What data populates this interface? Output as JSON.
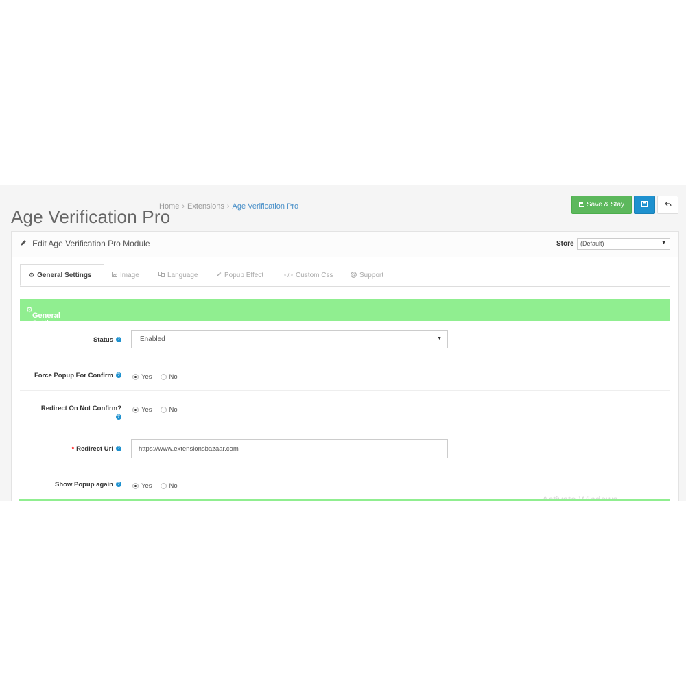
{
  "header": {
    "title": "Age Verification Pro",
    "breadcrumb": [
      "Home",
      "Extensions",
      "Age Verification Pro"
    ],
    "separator": "›"
  },
  "toolbar": {
    "save_stay_label": "Save & Stay",
    "save_icon": "floppy-icon",
    "back_icon": "reply-icon"
  },
  "panel": {
    "title": "Edit Age Verification Pro Module",
    "store_label": "Store",
    "store_value": "(Default)"
  },
  "tabs": [
    {
      "label": "General Settings",
      "icon": "cogs-icon",
      "active": true
    },
    {
      "label": "Image",
      "icon": "image-icon",
      "active": false
    },
    {
      "label": "Language",
      "icon": "language-icon",
      "active": false
    },
    {
      "label": "Popup Effect",
      "icon": "magic-icon",
      "active": false
    },
    {
      "label": "Custom Css",
      "icon": "code-icon",
      "active": false
    },
    {
      "label": "Support",
      "icon": "support-icon",
      "active": false
    }
  ],
  "section": {
    "title": "General Settings"
  },
  "form": {
    "status": {
      "label": "Status",
      "value": "Enabled"
    },
    "force_popup": {
      "label": "Force Popup For Confirm",
      "options": [
        "Yes",
        "No"
      ],
      "selected": "Yes"
    },
    "redirect_not_confirm": {
      "label": "Redirect On Not Confirm?",
      "options": [
        "Yes",
        "No"
      ],
      "selected": "Yes"
    },
    "redirect_url": {
      "label": "Redirect Url",
      "required_mark": "*",
      "value": "https://www.extensionsbazaar.com"
    },
    "show_popup_again": {
      "label": "Show Popup again",
      "options": [
        "Yes",
        "No"
      ],
      "selected": "Yes"
    }
  },
  "colors": {
    "success": "#5cb85c",
    "primary": "#1e91cf",
    "section_bar": "#90ee90",
    "breadcrumb_active": "#4a90c8"
  },
  "overlay": {
    "watermark": "Activate Windows"
  }
}
